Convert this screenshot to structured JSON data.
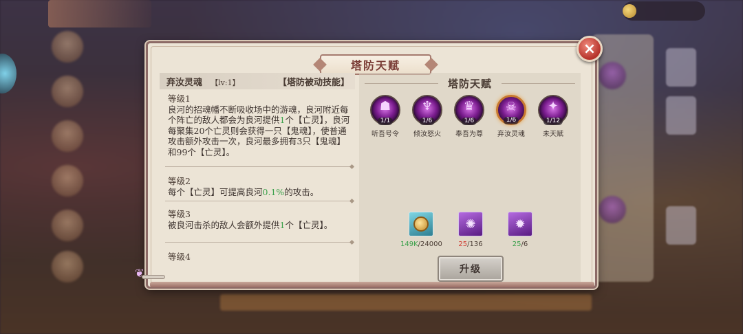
{
  "dialog": {
    "title": "塔防天赋",
    "close_icon": "×"
  },
  "skill": {
    "name": "弃汝灵魂",
    "level": "【lv:1】",
    "type": "【塔防被动技能】"
  },
  "tiers": [
    {
      "title": "等级1",
      "text_parts": [
        "良河的招魂幡不断吸收场中的游魂，良河附近每个阵亡的敌人都会为良河提供",
        "1",
        "个【亡灵】，良河每聚集20个亡灵则会获得一只【鬼魂】，使普通攻击额外攻击一次，良河最多拥有3只【鬼魂】和99个【亡灵】。"
      ]
    },
    {
      "title": "等级2",
      "text_parts": [
        "每个【亡灵】可提高良河",
        "0.1%",
        "的攻击。"
      ]
    },
    {
      "title": "等级3",
      "text_parts": [
        "被良河击杀的敌人会额外提供",
        "1",
        "个【亡灵】。"
      ]
    },
    {
      "title": "等级4",
      "text_parts": [
        "",
        "",
        ""
      ]
    }
  ],
  "talent_panel": {
    "title": "塔防天赋",
    "talents": [
      {
        "label": "听吾号令",
        "count": "1/1",
        "icon": "talent-command-icon",
        "glyph": "☗",
        "selected": false
      },
      {
        "label": "倾汝怒火",
        "count": "1/6",
        "icon": "talent-fury-icon",
        "glyph": "♆",
        "selected": false
      },
      {
        "label": "奉吾为尊",
        "count": "1/6",
        "icon": "talent-honor-icon",
        "glyph": "♛",
        "selected": false
      },
      {
        "label": "弃汝灵魂",
        "count": "1/6",
        "icon": "talent-soul-icon",
        "glyph": "☠",
        "selected": true
      },
      {
        "label": "未天赋",
        "count": "1/12",
        "icon": "talent-none-icon",
        "glyph": "✦",
        "selected": false
      }
    ],
    "costs": [
      {
        "icon": "copper-coin-icon",
        "have": "149K",
        "need": "24000",
        "status": "ok"
      },
      {
        "icon": "purple-crystal-icon",
        "have": "25",
        "need": "136",
        "status": "bad"
      },
      {
        "icon": "purple-flame-icon",
        "have": "25",
        "need": "6",
        "status": "ok"
      }
    ],
    "upgrade_label": "升级"
  },
  "colors": {
    "panel_bg": "#ece4d6",
    "panel_border": "#8c6a66",
    "title_red": "#7a3c36",
    "highlight_green": "#3aa04a",
    "insufficient_red": "#d03a30",
    "close_red": "#b5322a"
  }
}
